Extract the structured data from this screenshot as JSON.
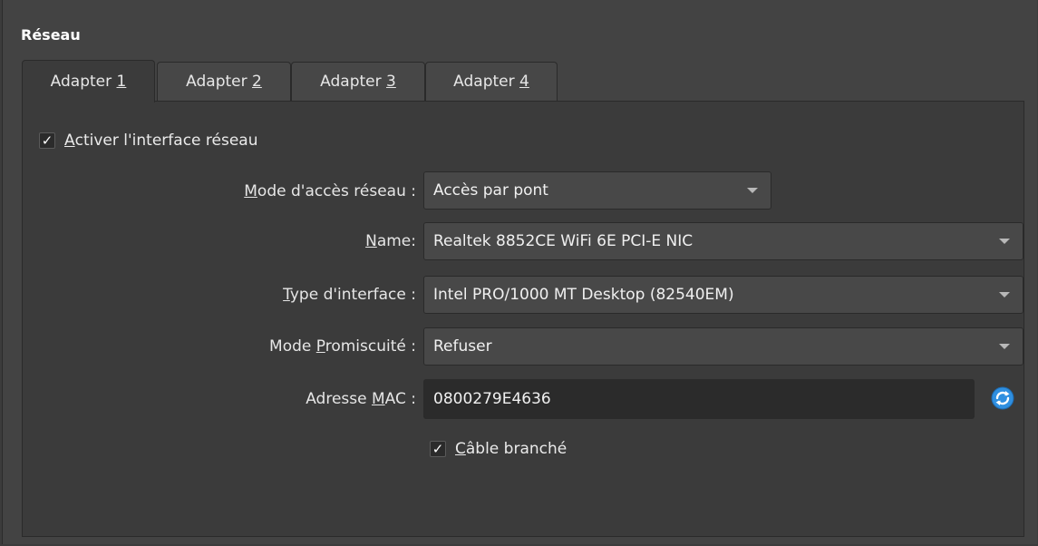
{
  "section_title": "Réseau",
  "tabs": [
    {
      "prefix": "Adapter ",
      "key": "1"
    },
    {
      "prefix": "Adapter ",
      "key": "2"
    },
    {
      "prefix": "Adapter ",
      "key": "3"
    },
    {
      "prefix": "Adapter ",
      "key": "4"
    }
  ],
  "enable_adapter": {
    "key": "A",
    "rest": "ctiver l'interface réseau",
    "checked": true,
    "check_glyph": "✓"
  },
  "fields": {
    "mode": {
      "label_key": "M",
      "label_rest": "ode d'accès réseau :",
      "value": "Accès par pont"
    },
    "name": {
      "label_key": "N",
      "label_rest": "ame:",
      "value": "Realtek 8852CE WiFi 6E PCI-E NIC"
    },
    "type": {
      "label_key": "T",
      "label_rest": "ype d'interface :",
      "value": "Intel PRO/1000 MT Desktop (82540EM)"
    },
    "promisc": {
      "label_pre": "Mode ",
      "label_key": "P",
      "label_rest": "romiscuité :",
      "value": "Refuser"
    },
    "mac": {
      "label_pre": "Adresse ",
      "label_key": "M",
      "label_rest": "AC :",
      "value": "0800279E4636"
    }
  },
  "cable": {
    "key": "C",
    "rest": "âble branché",
    "checked": true,
    "check_glyph": "✓"
  },
  "icons": {
    "refresh": "refresh-mac-icon",
    "dropdown": "chevron-down-icon"
  },
  "colors": {
    "panel_bg": "#3b3b3b",
    "field_bg": "#484848",
    "input_bg": "#2b2b2b",
    "refresh_blue": "#2f8fe0"
  }
}
